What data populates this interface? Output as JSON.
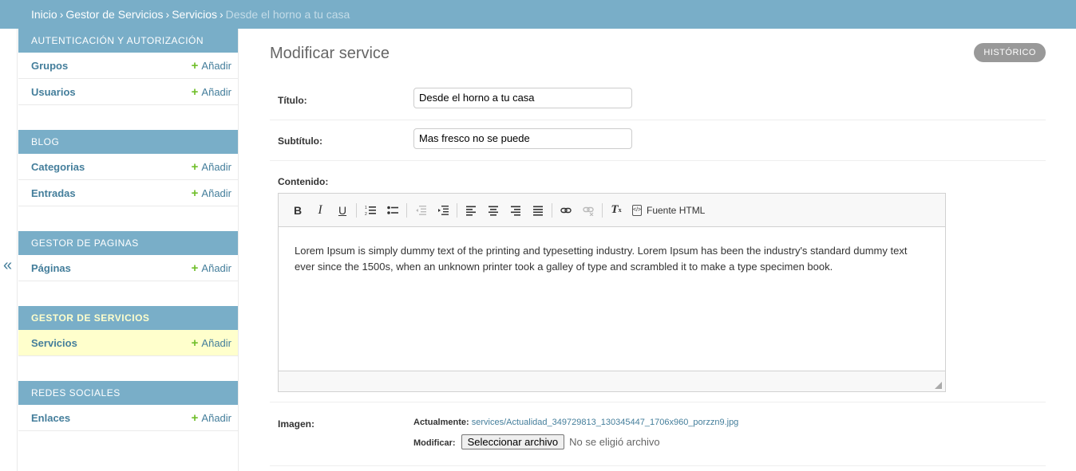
{
  "breadcrumbs": [
    {
      "label": "Inicio"
    },
    {
      "label": "Gestor de Servicios"
    },
    {
      "label": "Servicios"
    },
    {
      "label": "Desde el horno a tu casa"
    }
  ],
  "breadcrumb_separator": "›",
  "nav_toggle": "«",
  "sidebar": {
    "add_label": "Añadir",
    "modules": [
      {
        "caption": "Autenticación y autorización",
        "models": [
          "Grupos",
          "Usuarios"
        ]
      },
      {
        "caption": "Blog",
        "models": [
          "Categorias",
          "Entradas"
        ]
      },
      {
        "caption": "Gestor de paginas",
        "models": [
          "Páginas"
        ]
      },
      {
        "caption": "Gestor de servicios",
        "models": [
          "Servicios"
        ],
        "current": true
      },
      {
        "caption": "Redes sociales",
        "models": [
          "Enlaces"
        ]
      }
    ]
  },
  "page_title": "Modificar service",
  "history_button": "Histórico",
  "form": {
    "titulo_label": "Título:",
    "titulo_value": "Desde el horno a tu casa",
    "subtitulo_label": "Subtítulo:",
    "subtitulo_value": "Mas fresco no se puede",
    "contenido_label": "Contenido:",
    "source_label": "Fuente HTML",
    "contenido_text": "Lorem Ipsum is simply dummy text of the printing and typesetting industry. Lorem Ipsum has been the industry's standard dummy text ever since the 1500s, when an unknown printer took a galley of type and scrambled it to make a type specimen book.",
    "imagen_label": "Imagen:",
    "currently_label": "Actualmente:",
    "currently_file": "services/Actualidad_349729813_130345447_1706x960_porzzn9.jpg",
    "change_label": "Modificar:",
    "file_button": "Seleccionar archivo",
    "file_none": "No se eligió archivo"
  },
  "colors": {
    "header": "#79aec8",
    "link": "#447e9b",
    "add_plus": "#70bf2b",
    "active_row": "#ffffcc"
  }
}
